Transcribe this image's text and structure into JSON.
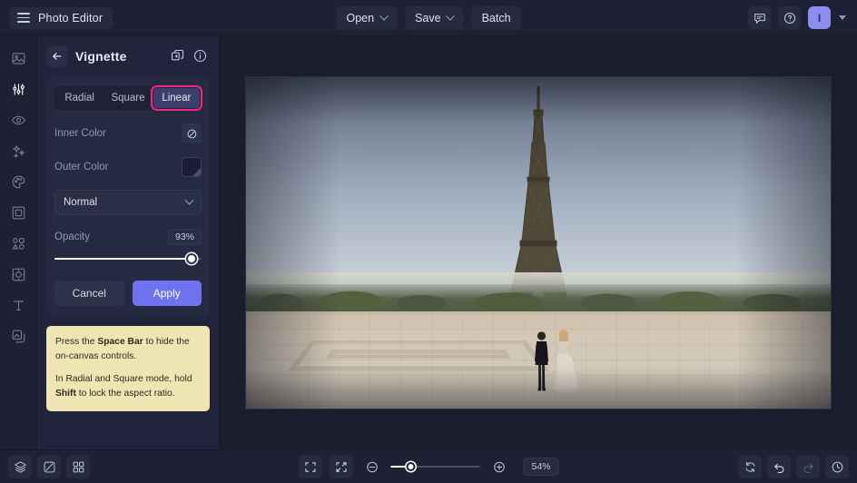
{
  "app": {
    "brand": "Photo Editor",
    "menu_icon": "hamburger-icon"
  },
  "topbar": {
    "open_label": "Open",
    "save_label": "Save",
    "batch_label": "Batch",
    "feedback_icon": "comment-icon",
    "help_icon": "help-circle-icon",
    "avatar_initial": "I"
  },
  "rail": {
    "items": [
      {
        "name": "image",
        "icon": "image-icon",
        "active": false
      },
      {
        "name": "adjust",
        "icon": "sliders-icon",
        "active": true
      },
      {
        "name": "retouch",
        "icon": "eye-icon",
        "active": false
      },
      {
        "name": "effects",
        "icon": "sparkles-icon",
        "active": false
      },
      {
        "name": "color",
        "icon": "palette-icon",
        "active": false
      },
      {
        "name": "frame",
        "icon": "frame-icon",
        "active": false
      },
      {
        "name": "shapes",
        "icon": "shapes-icon",
        "active": false
      },
      {
        "name": "crop",
        "icon": "crop-focus-icon",
        "active": false
      },
      {
        "name": "text",
        "icon": "text-t-icon",
        "active": false
      },
      {
        "name": "overlays",
        "icon": "layers-overlay-icon",
        "active": false
      }
    ]
  },
  "panel": {
    "title": "Vignette",
    "back_icon": "arrow-left-icon",
    "duplicate_icon": "add-layer-icon",
    "info_icon": "info-circle-icon",
    "shape_tabs": [
      {
        "label": "Radial",
        "active": false,
        "highlighted": false
      },
      {
        "label": "Square",
        "active": false,
        "highlighted": false
      },
      {
        "label": "Linear",
        "active": true,
        "highlighted": true
      }
    ],
    "inner_color": {
      "label": "Inner Color",
      "swatch": "none",
      "icon": "no-color-icon"
    },
    "outer_color": {
      "label": "Outer Color",
      "swatch": "#1a1d33"
    },
    "blend_mode": {
      "value": "Normal",
      "chevron": "chevron-down-icon"
    },
    "opacity": {
      "label": "Opacity",
      "value": "93%",
      "percent": 93
    },
    "cancel_label": "Cancel",
    "apply_label": "Apply"
  },
  "tip": {
    "line1_pre": "Press the ",
    "line1_bold": "Space Bar",
    "line1_post": " to hide the on-canvas controls.",
    "line2_pre": "In Radial and Square mode, hold ",
    "line2_bold": "Shift",
    "line2_post": " to lock the aspect ratio."
  },
  "bottombar": {
    "layers_icon": "layers-icon",
    "compare_icon": "compare-icon",
    "grid_icon": "grid-icon",
    "fit_icon": "fit-screen-icon",
    "collapse_icon": "collapse-icon",
    "zoom_out_icon": "zoom-out-icon",
    "zoom_in_icon": "zoom-in-icon",
    "zoom_value": "54%",
    "zoom_percent": 22,
    "reset_icon": "reset-icon",
    "undo_icon": "undo-icon",
    "redo_icon": "redo-icon",
    "history_icon": "history-icon"
  },
  "colors": {
    "accent": "#6f72ef",
    "highlight": "#f5257f",
    "panel_bg": "#21243a",
    "bar_bg": "#1e2133",
    "tip_bg": "#efe5b2"
  }
}
